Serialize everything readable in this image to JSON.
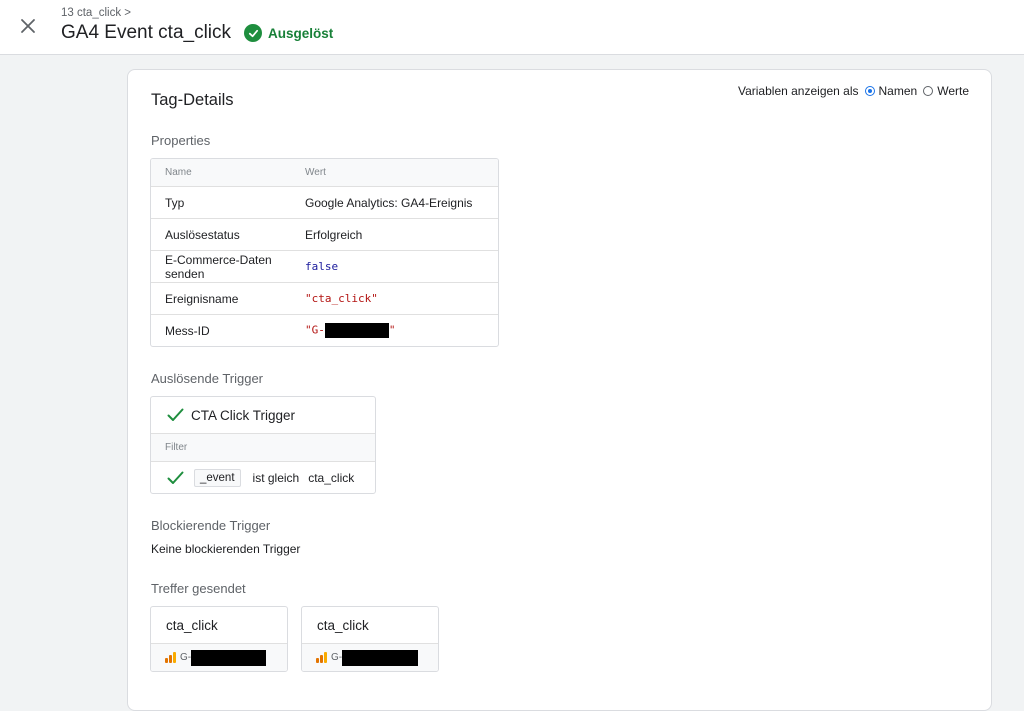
{
  "header": {
    "breadcrumb": "13 cta_click >",
    "title": "GA4 Event cta_click",
    "status": "Ausgelöst",
    "status_color": "#1e8e3e",
    "close_icon": "close-icon"
  },
  "card": {
    "title": "Tag-Details",
    "variables_toggle": {
      "label": "Variablen anzeigen als",
      "option_names": "Namen",
      "option_values": "Werte",
      "selected": "Namen"
    }
  },
  "properties": {
    "heading": "Properties",
    "columns": [
      "Name",
      "Wert"
    ],
    "rows": [
      {
        "name": "Typ",
        "value": "Google Analytics: GA4-Ereignis"
      },
      {
        "name": "Auslösestatus",
        "value": "Erfolgreich"
      },
      {
        "name": "E-Commerce-Daten senden",
        "value": "false"
      },
      {
        "name": "Ereignisname",
        "value": "\"cta_click\""
      },
      {
        "name": "Mess-ID",
        "value_prefix": "\"G-",
        "value_suffix": "\""
      }
    ]
  },
  "firing_triggers": {
    "heading": "Auslösende Trigger",
    "trigger_name": "CTA Click Trigger",
    "filter_label": "Filter",
    "condition": {
      "variable": "_event",
      "operator": "ist gleich",
      "value": "cta_click"
    }
  },
  "blocking_triggers": {
    "heading": "Blockierende Trigger",
    "empty_text": "Keine blockierenden Trigger"
  },
  "hits": {
    "heading": "Treffer gesendet",
    "items": [
      {
        "name": "cta_click",
        "id_prefix": "G-"
      },
      {
        "name": "cta_click",
        "id_prefix": "G-"
      }
    ]
  }
}
